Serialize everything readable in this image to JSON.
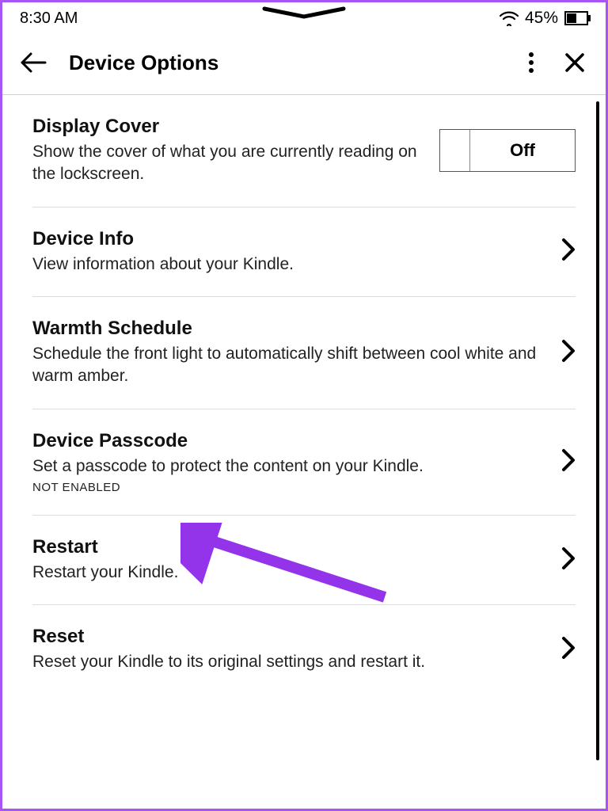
{
  "status": {
    "time": "8:30 AM",
    "battery": "45%"
  },
  "header": {
    "title": "Device Options"
  },
  "items": [
    {
      "title": "Display Cover",
      "desc": "Show the cover of what you are currently reading on the lockscreen.",
      "toggle": "Off"
    },
    {
      "title": "Device Info",
      "desc": "View information about your Kindle."
    },
    {
      "title": "Warmth Schedule",
      "desc": "Schedule the front light to automatically shift between cool white and warm amber."
    },
    {
      "title": "Device Passcode",
      "desc": "Set a passcode to protect the content on your Kindle.",
      "status": "NOT ENABLED"
    },
    {
      "title": "Restart",
      "desc": "Restart your Kindle."
    },
    {
      "title": "Reset",
      "desc": "Reset your Kindle to its original settings and restart it."
    }
  ]
}
